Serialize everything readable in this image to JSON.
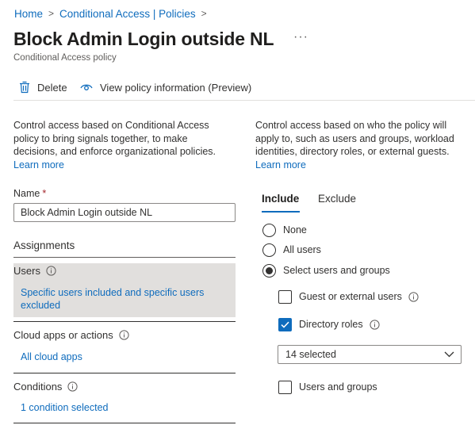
{
  "breadcrumb": {
    "items": [
      "Home",
      "Conditional Access | Policies"
    ],
    "separator": ">"
  },
  "page": {
    "title": "Block Admin Login outside NL",
    "more_label": "···",
    "subtitle": "Conditional Access policy"
  },
  "toolbar": {
    "delete_label": "Delete",
    "view_info_label": "View policy information (Preview)"
  },
  "left": {
    "description": "Control access based on Conditional Access policy to bring signals together, to make decisions, and enforce organizational policies.",
    "learn_more": "Learn more",
    "name_label": "Name",
    "name_required": "*",
    "name_value": "Block Admin Login outside NL",
    "assignments_heading": "Assignments",
    "users": {
      "label": "Users",
      "summary": "Specific users included and specific users excluded"
    },
    "cloud_apps": {
      "label": "Cloud apps or actions",
      "summary": "All cloud apps"
    },
    "conditions": {
      "label": "Conditions",
      "summary": "1 condition selected"
    }
  },
  "right": {
    "description": "Control access based on who the policy will apply to, such as users and groups, workload identities, directory roles, or external guests.",
    "learn_more": "Learn more",
    "tabs": [
      {
        "label": "Include",
        "selected": true
      },
      {
        "label": "Exclude",
        "selected": false
      }
    ],
    "radio_options": [
      {
        "label": "None",
        "checked": false
      },
      {
        "label": "All users",
        "checked": false
      },
      {
        "label": "Select users and groups",
        "checked": true
      }
    ],
    "checkboxes": {
      "guest": {
        "label": "Guest or external users",
        "checked": false
      },
      "directory_roles": {
        "label": "Directory roles",
        "checked": true
      },
      "users_groups": {
        "label": "Users and groups",
        "checked": false
      }
    },
    "roles_dropdown": {
      "value": "14 selected"
    }
  },
  "colors": {
    "accent": "#0f6cbd",
    "text": "#323130",
    "selected_row_bg": "#e1dfdd",
    "required": "#a4262c"
  },
  "icons": {
    "delete": "trash-icon",
    "view_info": "eye-icon",
    "info": "info-icon",
    "chevron": "chevron-down-icon",
    "checkmark": "checkmark-icon"
  }
}
